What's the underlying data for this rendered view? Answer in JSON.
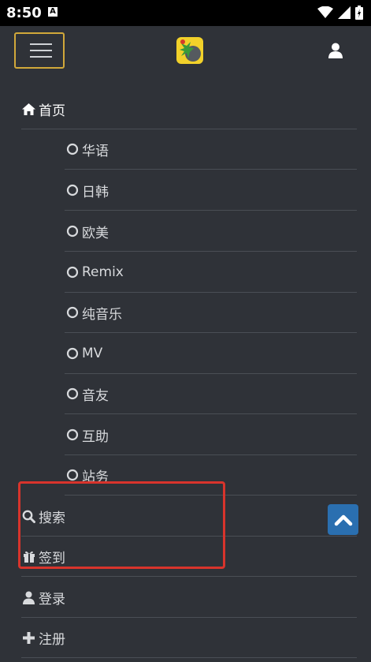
{
  "status_bar": {
    "time": "8:50",
    "notification_badge": "A"
  },
  "navbar": {
    "logo_icon": "app-logo",
    "user_icon": "user-icon"
  },
  "menu": {
    "home": "首页",
    "categories": [
      "华语",
      "日韩",
      "欧美",
      "Remix",
      "纯音乐",
      "MV",
      "音友",
      "互助",
      "站务"
    ],
    "search": "搜索",
    "checkin": "签到",
    "login": "登录",
    "register": "注册"
  },
  "colors": {
    "background": "#2f3238",
    "highlight": "#d8342c",
    "hamburger_border": "#d1a83a",
    "scroll_top": "#2a6fb0"
  }
}
